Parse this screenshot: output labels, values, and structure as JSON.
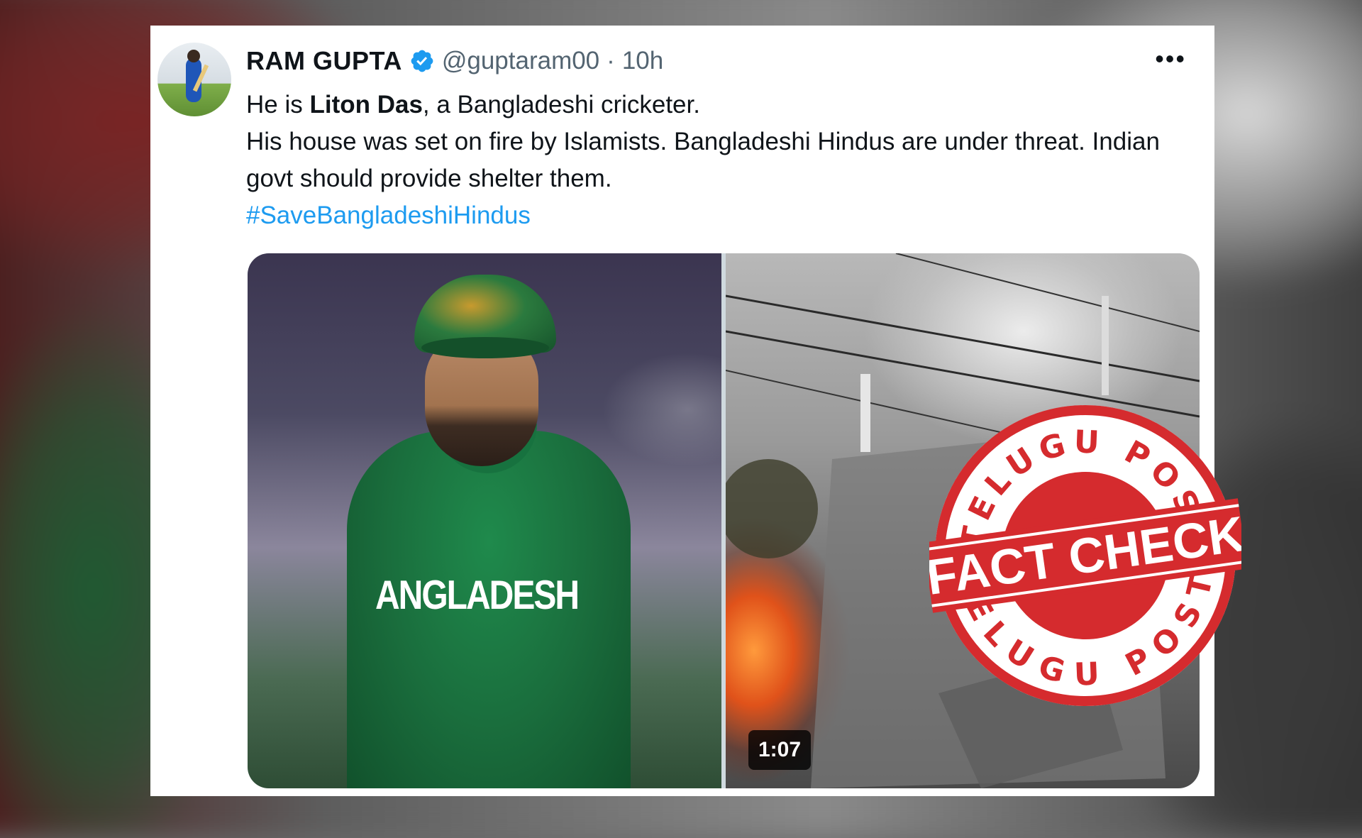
{
  "tweet": {
    "author_name": "RAM GUPTA",
    "handle": "@guptaram00",
    "separator": "·",
    "time": "10h",
    "more_label": "•••",
    "body_line1_prefix": "He is ",
    "body_line1_bold": "Liton Das",
    "body_line1_suffix": ", a Bangladeshi cricketer.",
    "body_line2": "His house was set on fire by Islamists. Bangladeshi  Hindus are under threat. Indian govt should provide shelter them.",
    "hashtag": "#SaveBangladeshiHindus"
  },
  "media": {
    "jersey_text": "ANGLADESH",
    "video_duration": "1:07"
  },
  "stamp": {
    "top_text": "TELUGU POST",
    "center_text": "FACT CHECK",
    "bottom_text": "TELUGU POST",
    "color": "#d52b2e"
  },
  "colors": {
    "link": "#1d9bf0",
    "verified": "#1d9bf0",
    "text": "#0f1419",
    "muted": "#536471"
  }
}
